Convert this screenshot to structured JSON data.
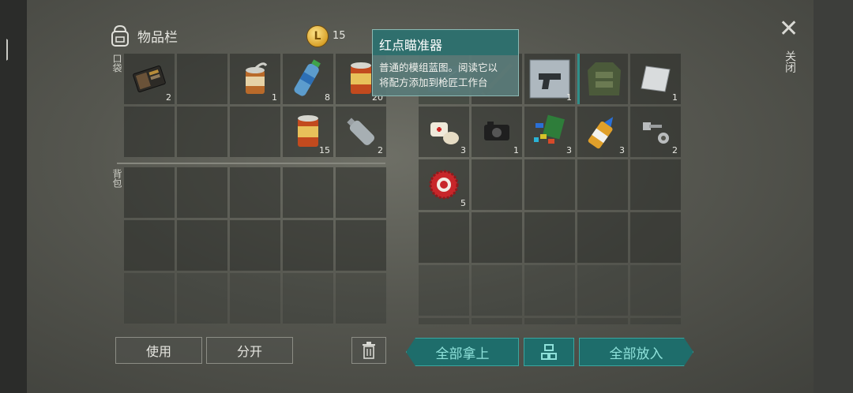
{
  "header": {
    "title": "物品栏"
  },
  "currency": {
    "count": "15"
  },
  "labels": {
    "pocket": "口袋",
    "backpack": "背包",
    "close": "关闭"
  },
  "buttons": {
    "use": "使用",
    "split": "分开",
    "take_all": "全部拿上",
    "put_all": "全部放入"
  },
  "tooltip": {
    "title": "红点瞄准器",
    "line1": "普通的模组蓝图。阅读它以",
    "line2": "将配方添加到枪匠工作台"
  },
  "left_slots": [
    {
      "icon": "wallet-icon",
      "qty": "2"
    },
    {
      "icon": "empty",
      "qty": ""
    },
    {
      "icon": "opened-can-icon",
      "qty": "1"
    },
    {
      "icon": "water-bottle-icon",
      "qty": "8"
    },
    {
      "icon": "food-can-icon",
      "qty": "20"
    },
    {
      "icon": "empty",
      "qty": ""
    },
    {
      "icon": "empty",
      "qty": ""
    },
    {
      "icon": "empty",
      "qty": ""
    },
    {
      "icon": "food-can-icon",
      "qty": "15"
    },
    {
      "icon": "empty-bottle-icon",
      "qty": "2"
    }
  ],
  "right_slots": [
    {
      "icon": "blueprint-icon",
      "qty": ""
    },
    {
      "icon": "rifle-icon",
      "qty": ""
    },
    {
      "icon": "pistol-blueprint-icon",
      "qty": "1"
    },
    {
      "icon": "jacket-icon",
      "qty": ""
    },
    {
      "icon": "metal-sheet-icon",
      "qty": "1"
    },
    {
      "icon": "bandage-icon",
      "qty": "3"
    },
    {
      "icon": "camera-icon",
      "qty": "1"
    },
    {
      "icon": "color-chips-icon",
      "qty": "3"
    },
    {
      "icon": "glue-icon",
      "qty": "3"
    },
    {
      "icon": "bolts-icon",
      "qty": "2"
    },
    {
      "icon": "bottle-cap-icon",
      "qty": "5"
    }
  ]
}
